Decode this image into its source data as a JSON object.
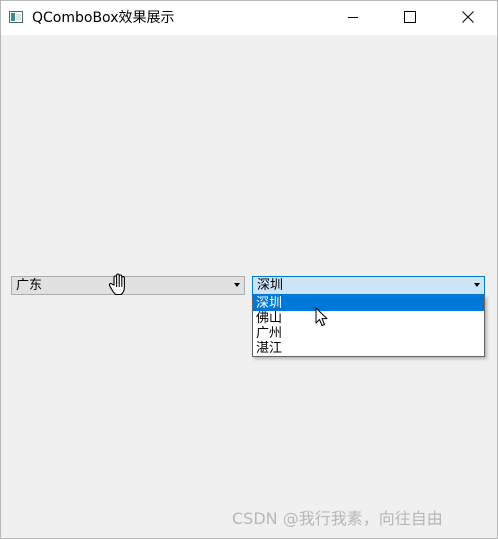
{
  "window": {
    "title": "QComboBox效果展示",
    "controls": {
      "minimize_icon": "minimize-icon",
      "maximize_icon": "maximize-icon",
      "close_icon": "close-icon"
    }
  },
  "province_combo": {
    "selected": "广东"
  },
  "city_combo": {
    "selected": "深圳",
    "options": [
      "深圳",
      "佛山",
      "广州",
      "湛江"
    ],
    "highlighted_index": 0
  },
  "watermark": "CSDN @我行我素，向往自由",
  "colors": {
    "highlight": "#0078d7",
    "focus_bg": "#cce4f7",
    "window_bg": "#f0f0f0"
  }
}
